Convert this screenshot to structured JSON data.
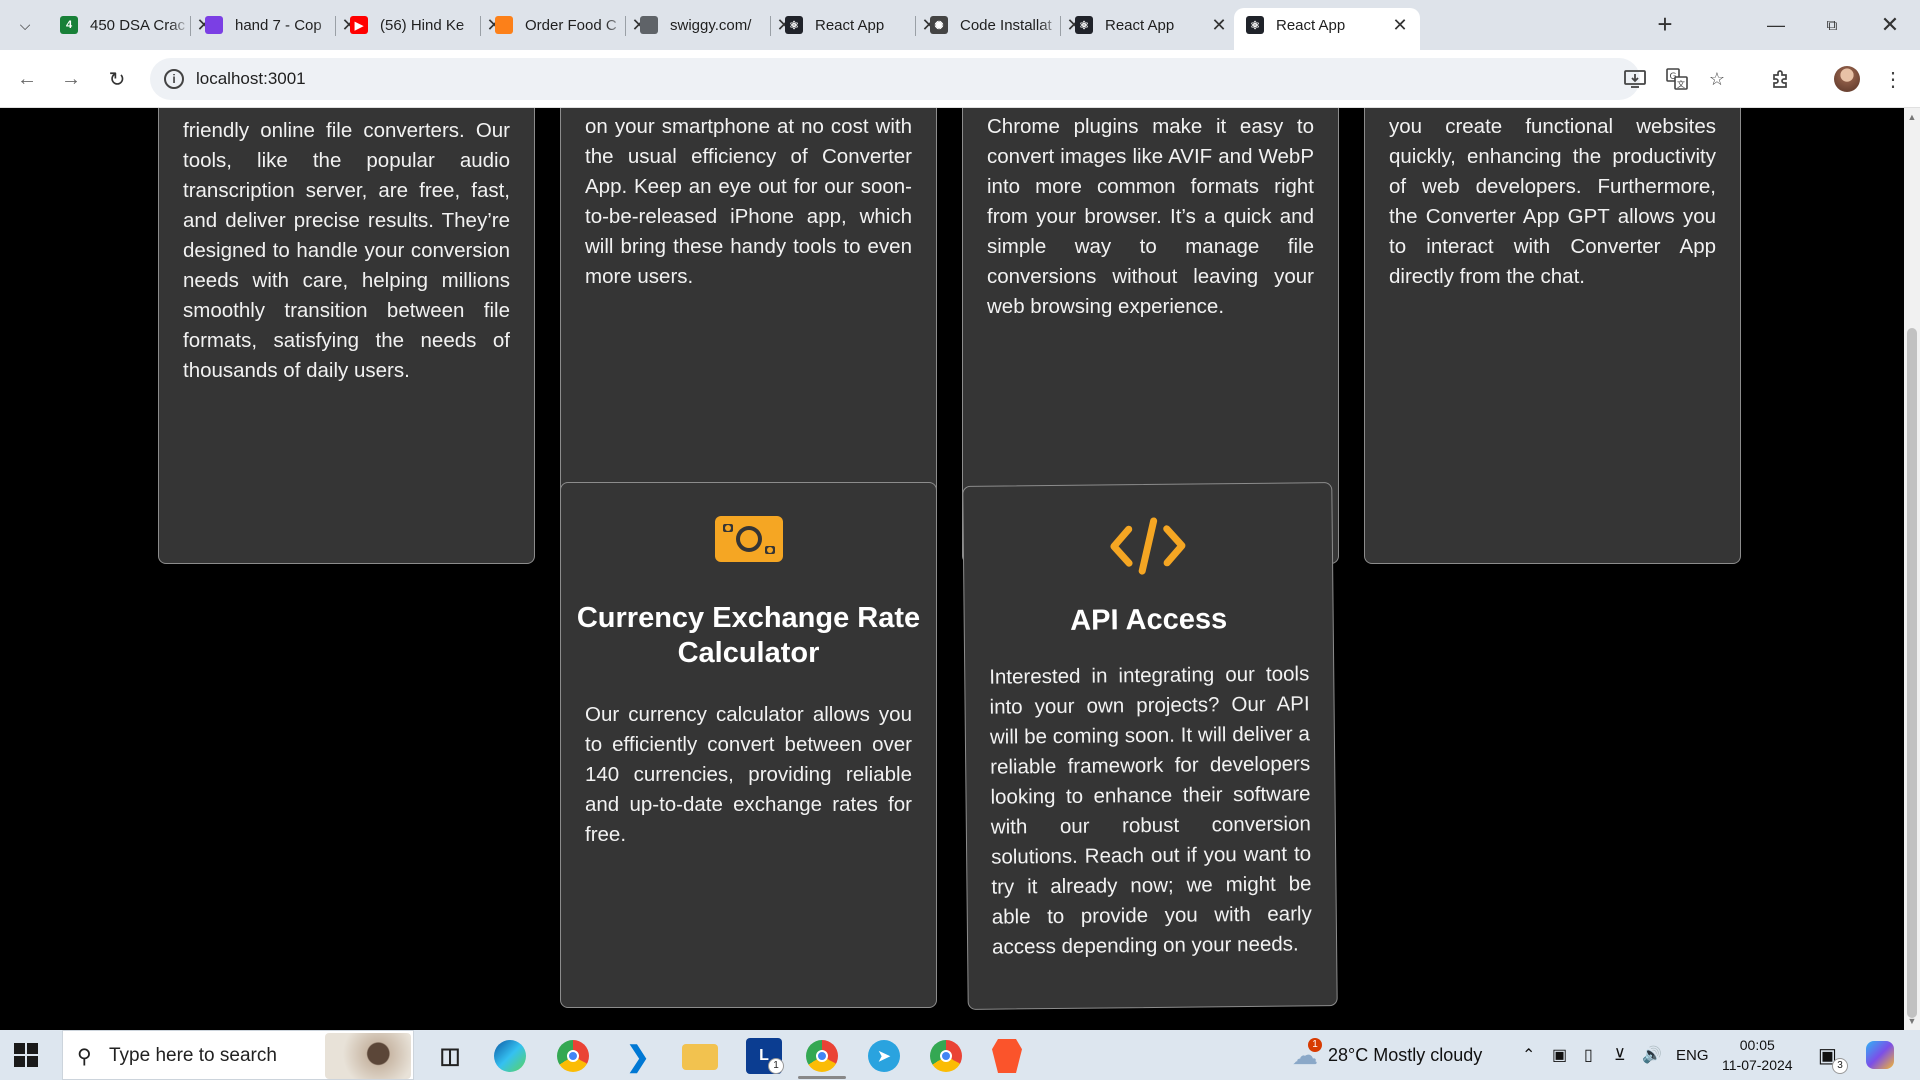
{
  "browser": {
    "tabs": [
      {
        "title": "450 DSA Crac",
        "favicon": "sheets-icon",
        "color": "#188038",
        "glyph": "4"
      },
      {
        "title": "hand 7 - Cop",
        "favicon": "copilot-icon",
        "color": "#7b3fe4",
        "glyph": ""
      },
      {
        "title": "(56) Hind Ke",
        "favicon": "youtube-icon",
        "color": "#ff0000",
        "glyph": "▶"
      },
      {
        "title": "Order Food C",
        "favicon": "swiggy-icon",
        "color": "#fc8019",
        "glyph": ""
      },
      {
        "title": "swiggy.com/",
        "favicon": "globe-icon",
        "color": "#5f6368",
        "glyph": ""
      },
      {
        "title": "React App",
        "favicon": "react-icon",
        "color": "#20232a",
        "glyph": "⚛"
      },
      {
        "title": "Code Installat",
        "favicon": "chatgpt-icon",
        "color": "#444",
        "glyph": "✺"
      },
      {
        "title": "React App",
        "favicon": "react-icon",
        "color": "#20232a",
        "glyph": "⚛"
      },
      {
        "title": "React App",
        "favicon": "react-icon",
        "color": "#20232a",
        "glyph": "⚛",
        "active": true
      }
    ],
    "url": "localhost:3001"
  },
  "page": {
    "top_cards": [
      {
        "text": "friendly online file converters. Our tools, like the popular audio transcription server, are free, fast, and deliver precise results. They’re designed to handle your conversion needs with care, helping millions smoothly transition between file formats, satisfying the needs of thousands of daily users."
      },
      {
        "text": "on your smartphone at no cost with the usual efficiency of Converter App. Keep an eye out for our soon-to-be-released iPhone app, which will bring these handy tools to even more users."
      },
      {
        "text": "Chrome plugins make it easy to convert images like AVIF and WebP into more common formats right from your browser. It’s a quick and simple way to manage file conversions without leaving your web browsing experience."
      },
      {
        "text": "you create functional websites quickly, enhancing the productivity of web developers. Furthermore, the Converter App GPT allows you to interact with Converter App directly from the chat."
      }
    ],
    "currency_card": {
      "icon": "money-bill-icon",
      "title": "Currency Exchange Rate Calculator",
      "text": "Our currency calculator allows you to efficiently convert between over 140 currencies, providing reliable and up-to-date exchange rates for free."
    },
    "api_card": {
      "icon": "code-icon",
      "title": "API Access",
      "text": "Interested in integrating our tools into your own projects? Our API will be coming soon. It will deliver a reliable framework for developers looking to enhance their software with our robust conversion solutions. Reach out if you want to try it already now; we might be able to provide you with early access depending on your needs."
    },
    "accent_color": "#f5a623",
    "card_bg": "#353535"
  },
  "taskbar": {
    "search_placeholder": "Type here to search",
    "weather": "28°C  Mostly cloudy",
    "language": "ENG",
    "time": "00:05",
    "date": "11-07-2024",
    "notification_count": "3",
    "weather_alert": "1",
    "teams_badge": "1"
  }
}
